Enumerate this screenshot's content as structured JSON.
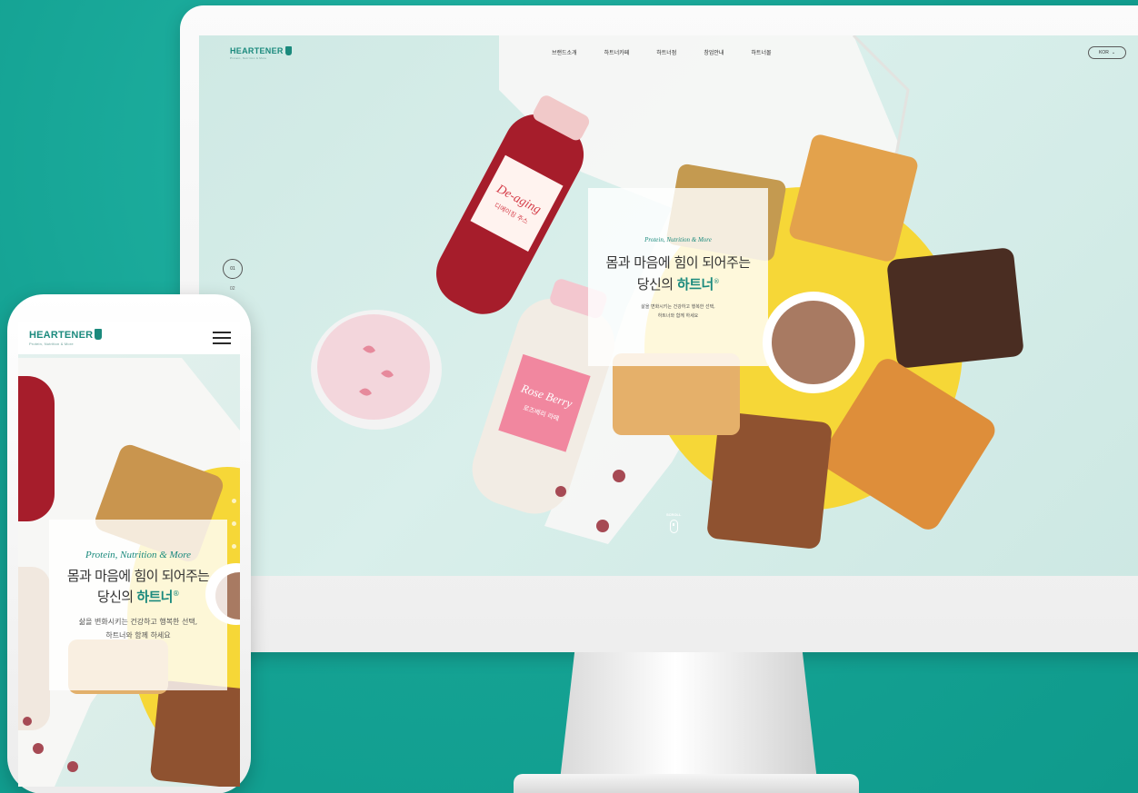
{
  "colors": {
    "background": "#14a293",
    "brand": "#1b8a7d",
    "card": "#ffffff"
  },
  "desktop": {
    "logo": "HEARTENER",
    "logo_sub": "Protein, Nutrition & More",
    "nav": [
      "브랜드소개",
      "하트너카페",
      "하트너점",
      "창업안내",
      "하트너몰"
    ],
    "language": "KOR",
    "pager": {
      "current": "01",
      "next": "02"
    },
    "hero": {
      "tag": "Protein, Nutrition & More",
      "line1": "몸과 마음에 힘이 되어주는",
      "line2_prefix": "당신의 ",
      "brand": "하트너",
      "reg": "®",
      "desc1": "삶을 변화시키는 건강하고 행복한 선택,",
      "desc2": "하트너와 함께 하세요"
    },
    "scroll_label": "SCROLL",
    "product_labels": {
      "red_bottle_line1": "De-aging",
      "red_bottle_line2": "디에이징 주스",
      "pink_bottle_line1": "Rose Berry",
      "pink_bottle_line2": "로즈베리 라떼"
    }
  },
  "mobile": {
    "logo": "HEARTENER",
    "logo_sub": "Protein, Nutrition & More",
    "hero": {
      "tag": "Protein, Nutrition & More",
      "line1": "몸과 마음에 힘이 되어주는",
      "line2_prefix": "당신의 ",
      "brand": "하트너",
      "reg": "®",
      "desc1": "삶을 변화시키는 건강하고 행복한 선택,",
      "desc2": "하트너와 함께 하세요"
    }
  }
}
